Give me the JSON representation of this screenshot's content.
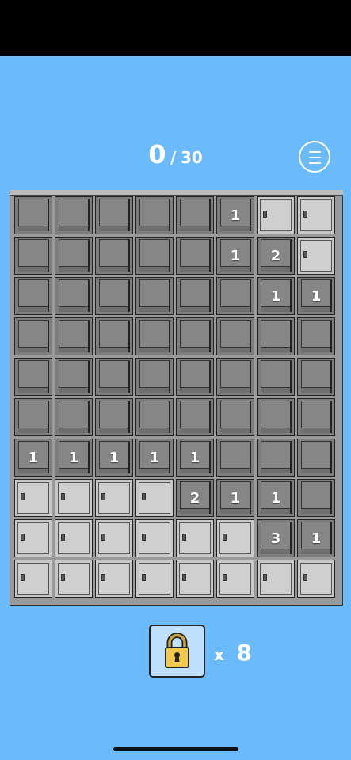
{
  "score": {
    "found": "0",
    "separator": "/",
    "total": "30"
  },
  "board": {
    "rows": [
      [
        {
          "s": "open",
          "n": ""
        },
        {
          "s": "open",
          "n": ""
        },
        {
          "s": "open",
          "n": ""
        },
        {
          "s": "open",
          "n": ""
        },
        {
          "s": "open",
          "n": ""
        },
        {
          "s": "open",
          "n": "1"
        },
        {
          "s": "closed",
          "n": ""
        },
        {
          "s": "closed",
          "n": ""
        }
      ],
      [
        {
          "s": "open",
          "n": ""
        },
        {
          "s": "open",
          "n": ""
        },
        {
          "s": "open",
          "n": ""
        },
        {
          "s": "open",
          "n": ""
        },
        {
          "s": "open",
          "n": ""
        },
        {
          "s": "open",
          "n": "1"
        },
        {
          "s": "open",
          "n": "2"
        },
        {
          "s": "closed",
          "n": ""
        }
      ],
      [
        {
          "s": "open",
          "n": ""
        },
        {
          "s": "open",
          "n": ""
        },
        {
          "s": "open",
          "n": ""
        },
        {
          "s": "open",
          "n": ""
        },
        {
          "s": "open",
          "n": ""
        },
        {
          "s": "open",
          "n": ""
        },
        {
          "s": "open",
          "n": "1"
        },
        {
          "s": "open",
          "n": "1"
        }
      ],
      [
        {
          "s": "open",
          "n": ""
        },
        {
          "s": "open",
          "n": ""
        },
        {
          "s": "open",
          "n": ""
        },
        {
          "s": "open",
          "n": ""
        },
        {
          "s": "open",
          "n": ""
        },
        {
          "s": "open",
          "n": ""
        },
        {
          "s": "open",
          "n": ""
        },
        {
          "s": "open",
          "n": ""
        }
      ],
      [
        {
          "s": "open",
          "n": ""
        },
        {
          "s": "open",
          "n": ""
        },
        {
          "s": "open",
          "n": ""
        },
        {
          "s": "open",
          "n": ""
        },
        {
          "s": "open",
          "n": ""
        },
        {
          "s": "open",
          "n": ""
        },
        {
          "s": "open",
          "n": ""
        },
        {
          "s": "open",
          "n": ""
        }
      ],
      [
        {
          "s": "open",
          "n": ""
        },
        {
          "s": "open",
          "n": ""
        },
        {
          "s": "open",
          "n": ""
        },
        {
          "s": "open",
          "n": ""
        },
        {
          "s": "open",
          "n": ""
        },
        {
          "s": "open",
          "n": ""
        },
        {
          "s": "open",
          "n": ""
        },
        {
          "s": "open",
          "n": ""
        }
      ],
      [
        {
          "s": "open",
          "n": "1"
        },
        {
          "s": "open",
          "n": "1"
        },
        {
          "s": "open",
          "n": "1"
        },
        {
          "s": "open",
          "n": "1"
        },
        {
          "s": "open",
          "n": "1"
        },
        {
          "s": "open",
          "n": ""
        },
        {
          "s": "open",
          "n": ""
        },
        {
          "s": "open",
          "n": ""
        }
      ],
      [
        {
          "s": "closed",
          "n": ""
        },
        {
          "s": "closed",
          "n": ""
        },
        {
          "s": "closed",
          "n": ""
        },
        {
          "s": "closed",
          "n": ""
        },
        {
          "s": "open",
          "n": "2"
        },
        {
          "s": "open",
          "n": "1"
        },
        {
          "s": "open",
          "n": "1"
        },
        {
          "s": "open",
          "n": ""
        }
      ],
      [
        {
          "s": "closed",
          "n": ""
        },
        {
          "s": "closed",
          "n": ""
        },
        {
          "s": "closed",
          "n": ""
        },
        {
          "s": "closed",
          "n": ""
        },
        {
          "s": "closed",
          "n": ""
        },
        {
          "s": "closed",
          "n": ""
        },
        {
          "s": "open",
          "n": "3"
        },
        {
          "s": "open",
          "n": "1"
        }
      ],
      [
        {
          "s": "closed",
          "n": ""
        },
        {
          "s": "closed",
          "n": ""
        },
        {
          "s": "closed",
          "n": ""
        },
        {
          "s": "closed",
          "n": ""
        },
        {
          "s": "closed",
          "n": ""
        },
        {
          "s": "closed",
          "n": ""
        },
        {
          "s": "closed",
          "n": ""
        },
        {
          "s": "closed",
          "n": ""
        }
      ]
    ]
  },
  "lock": {
    "icon": "padlock-icon",
    "multiplier": "x",
    "count": "8",
    "color": "#f2c94c"
  }
}
